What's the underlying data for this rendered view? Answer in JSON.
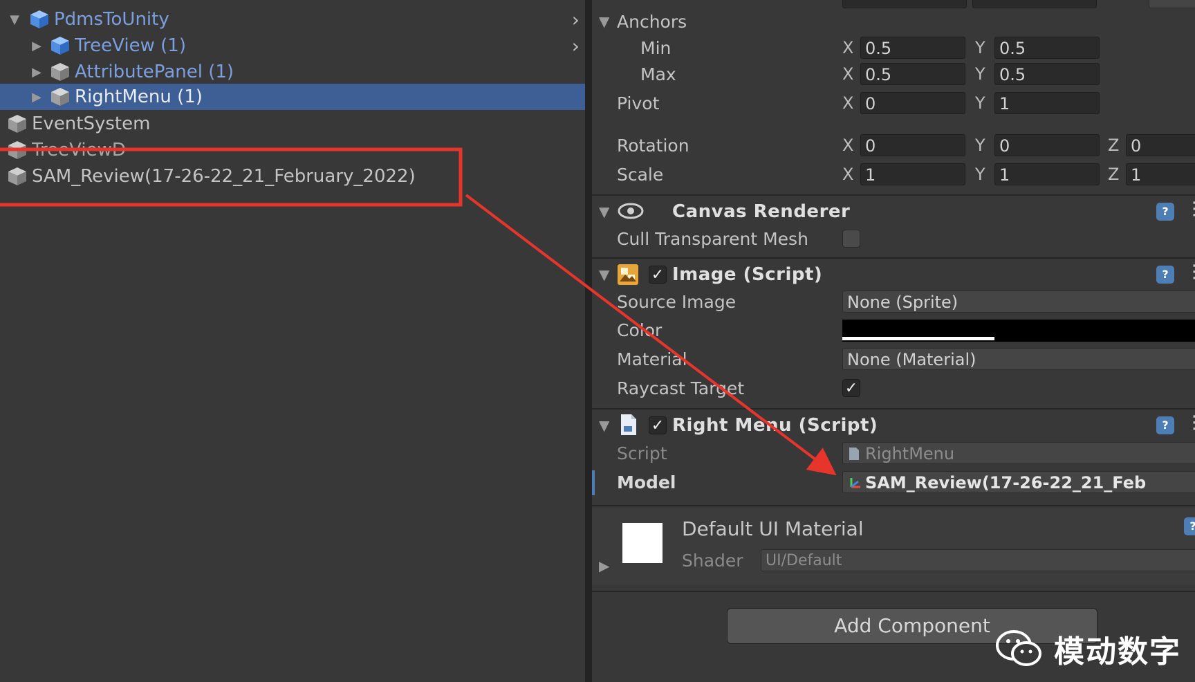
{
  "hierarchy": {
    "items": [
      {
        "label": "PdmsToUnity"
      },
      {
        "label": "TreeView (1)"
      },
      {
        "label": "AttributePanel (1)"
      },
      {
        "label": "RightMenu (1)"
      },
      {
        "label": "EventSystem"
      },
      {
        "label": "TreeViewD"
      },
      {
        "label": "SAM_Review(17-26-22_21_February_2022)"
      }
    ]
  },
  "inspector": {
    "anchors": {
      "label": "Anchors",
      "min_label": "Min",
      "min_x": "0.5",
      "min_y": "0.5",
      "max_label": "Max",
      "max_x": "0.5",
      "max_y": "0.5"
    },
    "pivot": {
      "label": "Pivot",
      "x": "0",
      "y": "1"
    },
    "rotation": {
      "label": "Rotation",
      "x": "0",
      "y": "0",
      "z": "0"
    },
    "scale": {
      "label": "Scale",
      "x": "1",
      "y": "1",
      "z": "1"
    },
    "axes": {
      "x": "X",
      "y": "Y",
      "z": "Z"
    },
    "canvas_renderer": {
      "title": "Canvas Renderer",
      "cull_label": "Cull Transparent Mesh"
    },
    "image_script": {
      "title": "Image (Script)",
      "source_label": "Source Image",
      "source_value": "None (Sprite)",
      "color_label": "Color",
      "material_label": "Material",
      "material_value": "None (Material)",
      "raycast_label": "Raycast Target"
    },
    "right_menu_script": {
      "title": "Right Menu (Script)",
      "script_label": "Script",
      "script_value": "RightMenu",
      "model_label": "Model",
      "model_value": "SAM_Review(17-26-22_21_Feb"
    },
    "material_preview": {
      "title": "Default UI Material",
      "shader_label": "Shader",
      "shader_value": "UI/Default"
    },
    "add_component": "Add Component"
  },
  "watermark": "模动数字",
  "colors": {
    "selection": "#3e5f96",
    "prefab_text": "#7c9fe0",
    "annotation": "#e8352b",
    "help_icon": "#4d7fb6"
  }
}
